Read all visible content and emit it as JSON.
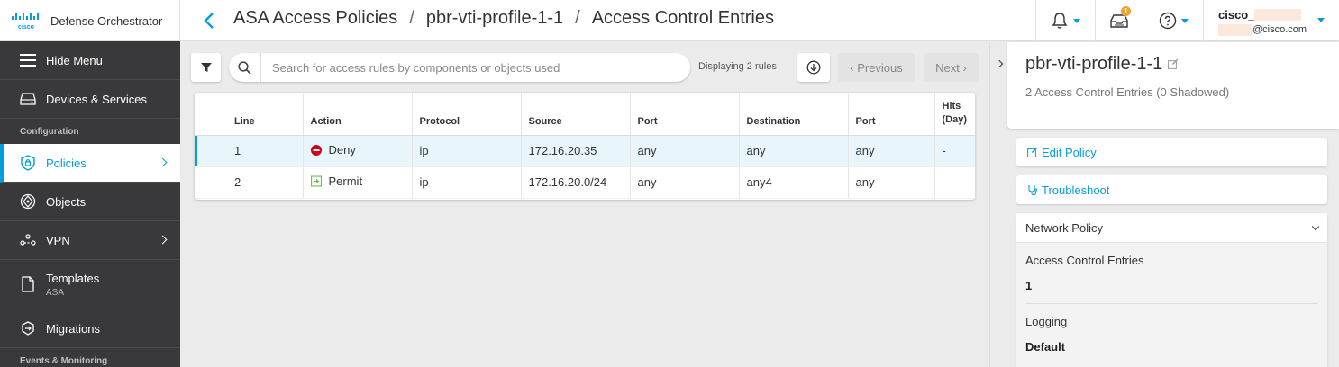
{
  "brand": {
    "app_name": "Defense Orchestrator"
  },
  "breadcrumb": [
    "ASA Access Policies",
    "pbr-vti-profile-1-1",
    "Access Control Entries"
  ],
  "header": {
    "notification_count": "1",
    "user_name": "cisco_",
    "user_email": "@cisco.com"
  },
  "sidebar": {
    "hide_menu": "Hide Menu",
    "devices": "Devices & Services",
    "section_config": "Configuration",
    "policies": "Policies",
    "objects": "Objects",
    "vpn": "VPN",
    "templates": "Templates",
    "templates_sub": "ASA",
    "migrations": "Migrations",
    "section_events": "Events & Monitoring"
  },
  "toolbar": {
    "search_placeholder": "Search for access rules by components or objects used",
    "count_text": "Displaying 2 rules",
    "previous": "Previous",
    "next": "Next"
  },
  "table": {
    "columns": [
      "Line",
      "Action",
      "Protocol",
      "Source",
      "Port",
      "Destination",
      "Port",
      "Hits (Day)"
    ],
    "rows": [
      {
        "line": "1",
        "action": "Deny",
        "protocol": "ip",
        "source": "172.16.20.35",
        "src_port": "any",
        "destination": "any",
        "dst_port": "any",
        "hits": "-"
      },
      {
        "line": "2",
        "action": "Permit",
        "protocol": "ip",
        "source": "172.16.20.0/24",
        "src_port": "any",
        "destination": "any4",
        "dst_port": "any",
        "hits": "-"
      }
    ]
  },
  "panel": {
    "title": "pbr-vti-profile-1-1",
    "subtitle": "2 Access Control Entries (0 Shadowed)",
    "edit_policy": "Edit Policy",
    "troubleshoot": "Troubleshoot",
    "network_policy": "Network Policy",
    "ace_label": "Access Control Entries",
    "ace_value": "1",
    "logging_label": "Logging",
    "logging_value": "Default"
  },
  "colors": {
    "accent": "#049fd9",
    "sidebar_bg": "#39393b",
    "deny": "#d0021b",
    "permit": "#6cc04a",
    "badge": "#f0a22e"
  }
}
